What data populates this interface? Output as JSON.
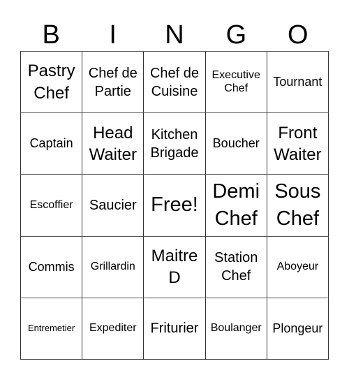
{
  "title_letters": [
    "B",
    "I",
    "N",
    "G",
    "O"
  ],
  "cells": [
    [
      "Pastry Chef",
      "Chef de Partie",
      "Chef de Cuisine",
      "Executive Chef",
      "Tournant"
    ],
    [
      "Captain",
      "Head Waiter",
      "Kitchen Brigade",
      "Boucher",
      "Front Waiter"
    ],
    [
      "Escoffier",
      "Saucier",
      "Free!",
      "Demi Chef",
      "Sous Chef"
    ],
    [
      "Commis",
      "Grillardin",
      "Maitre D",
      "Station Chef",
      "Aboyeur"
    ],
    [
      "Entremetier",
      "Expediter",
      "Friturier",
      "Boulanger",
      "Plongeur"
    ]
  ]
}
